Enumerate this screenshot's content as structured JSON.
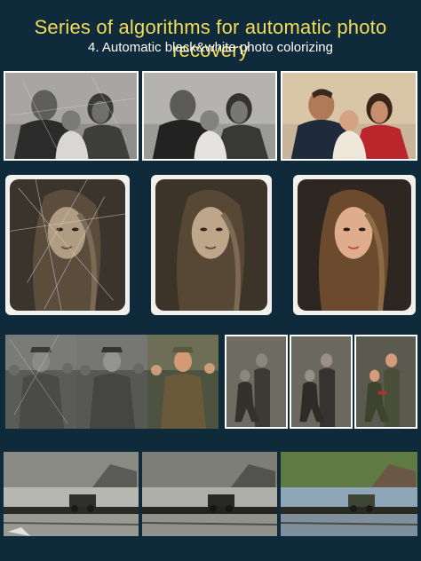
{
  "header": {
    "title": "Series of algorithms for automatic photo recovery",
    "subtitle": "4. Automatic black&white photo colorizing"
  },
  "colors": {
    "background": "#0f2a3a",
    "title": "#f2dc5a",
    "subtitle": "#ffffff"
  },
  "rows": [
    {
      "subject": "family portrait",
      "stages": [
        "damaged",
        "restored",
        "colorized"
      ]
    },
    {
      "subject": "woman portrait",
      "stages": [
        "damaged",
        "restored",
        "colorized"
      ]
    },
    {
      "subject": "soldiers",
      "stages": [
        "damaged",
        "restored",
        "colorized",
        "damaged",
        "restored",
        "colorized"
      ]
    },
    {
      "subject": "river with military truck",
      "stages": [
        "damaged",
        "restored",
        "colorized"
      ]
    }
  ]
}
